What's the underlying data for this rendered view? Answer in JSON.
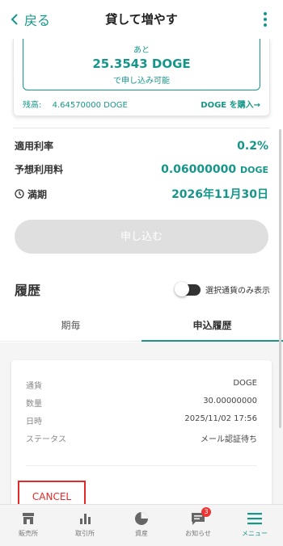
{
  "header": {
    "back_label": "戻る",
    "title": "貸して増やす"
  },
  "summary": {
    "prefix": "あと",
    "amount": "25.3543 DOGE",
    "suffix": "で申し込み可能",
    "balance_label": "残高:",
    "balance_value": "4.64570000 DOGE",
    "buy_link": "DOGE を購入→"
  },
  "details": {
    "rate_label": "適用利率",
    "rate_value": "0.2%",
    "fee_label": "予想利用料",
    "fee_value": "0.06000000",
    "fee_unit": "DOGE",
    "maturity_label": "満期",
    "maturity_value": "2026年11月30日"
  },
  "apply_button": "申し込む",
  "history": {
    "title": "履歴",
    "toggle_label": "選択通貨のみ表示",
    "toggle_on": false,
    "tabs": [
      {
        "label": "期毎",
        "active": false
      },
      {
        "label": "申込履歴",
        "active": true
      }
    ],
    "entry": {
      "rows": [
        {
          "key": "通貨",
          "value": "DOGE"
        },
        {
          "key": "数量",
          "value": "30.00000000"
        },
        {
          "key": "日時",
          "value": "2025/11/02 17:56"
        },
        {
          "key": "ステータス",
          "value": "メール認証待ち"
        }
      ],
      "cancel_label": "CANCEL"
    }
  },
  "bottom_nav": [
    {
      "label": "販売所",
      "icon": "shop-icon"
    },
    {
      "label": "取引所",
      "icon": "bar-chart-icon"
    },
    {
      "label": "資産",
      "icon": "pie-chart-icon"
    },
    {
      "label": "お知らせ",
      "icon": "notification-icon",
      "badge": "3"
    },
    {
      "label": "メニュー",
      "icon": "menu-icon",
      "active": true
    }
  ],
  "colors": {
    "accent": "#16968a",
    "danger": "#e32a2a",
    "disabled": "#dfdfdf"
  }
}
